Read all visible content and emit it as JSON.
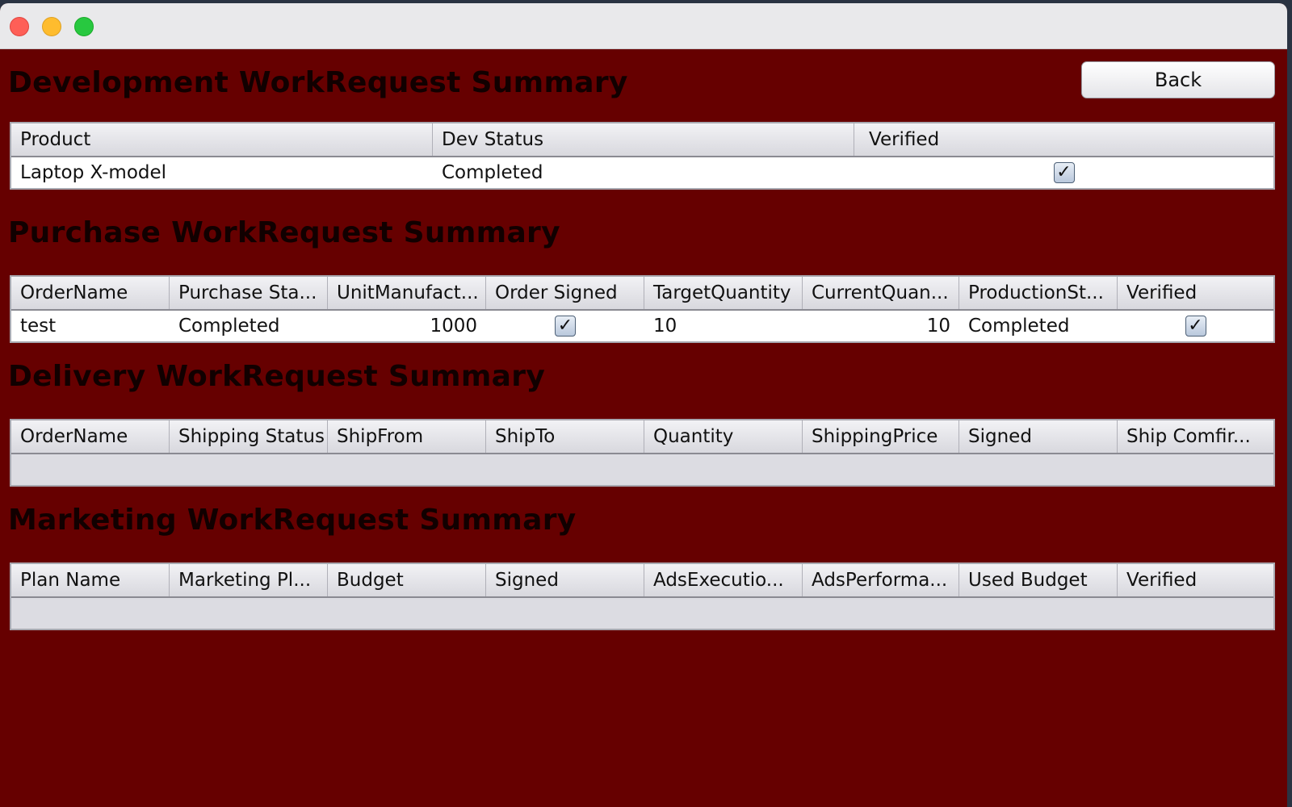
{
  "window": {
    "controls": [
      "close-button",
      "minimize-button",
      "zoom-button"
    ]
  },
  "back_button": {
    "label": "Back"
  },
  "development": {
    "title": "Development WorkRequest Summary",
    "columns": [
      "Product",
      "Dev Status",
      "Verified"
    ],
    "rows": [
      {
        "product": "Laptop X-model",
        "dev_status": "Completed",
        "verified": true
      }
    ]
  },
  "purchase": {
    "title": "Purchase WorkRequest Summary",
    "columns": [
      "OrderName",
      "Purchase Sta...",
      "UnitManufact...",
      "Order Signed",
      "TargetQuantity",
      "CurrentQuan...",
      "ProductionSt...",
      "Verified"
    ],
    "rows": [
      {
        "order_name": "test",
        "purchase_status": "Completed",
        "unit_manufacture": "1000",
        "order_signed": true,
        "target_quantity": "10",
        "current_quantity": "10",
        "production_status": "Completed",
        "verified": true
      }
    ]
  },
  "delivery": {
    "title": "Delivery WorkRequest Summary",
    "columns": [
      "OrderName",
      "Shipping Status",
      "ShipFrom",
      "ShipTo",
      "Quantity",
      "ShippingPrice",
      "Signed",
      "Ship Comfir..."
    ],
    "rows": []
  },
  "marketing": {
    "title": "Marketing WorkRequest Summary",
    "columns": [
      "Plan Name",
      "Marketing Pl...",
      "Budget",
      "Signed",
      "AdsExecutio...",
      "AdsPerforma...",
      "Used Budget",
      "Verified"
    ],
    "rows": []
  },
  "icons": {
    "checkbox_checked": "check-icon",
    "checkmark_glyph": "✓"
  },
  "colors": {
    "background": "#660000",
    "title_text": "#110000",
    "titlebar": "#e9e9eb"
  }
}
